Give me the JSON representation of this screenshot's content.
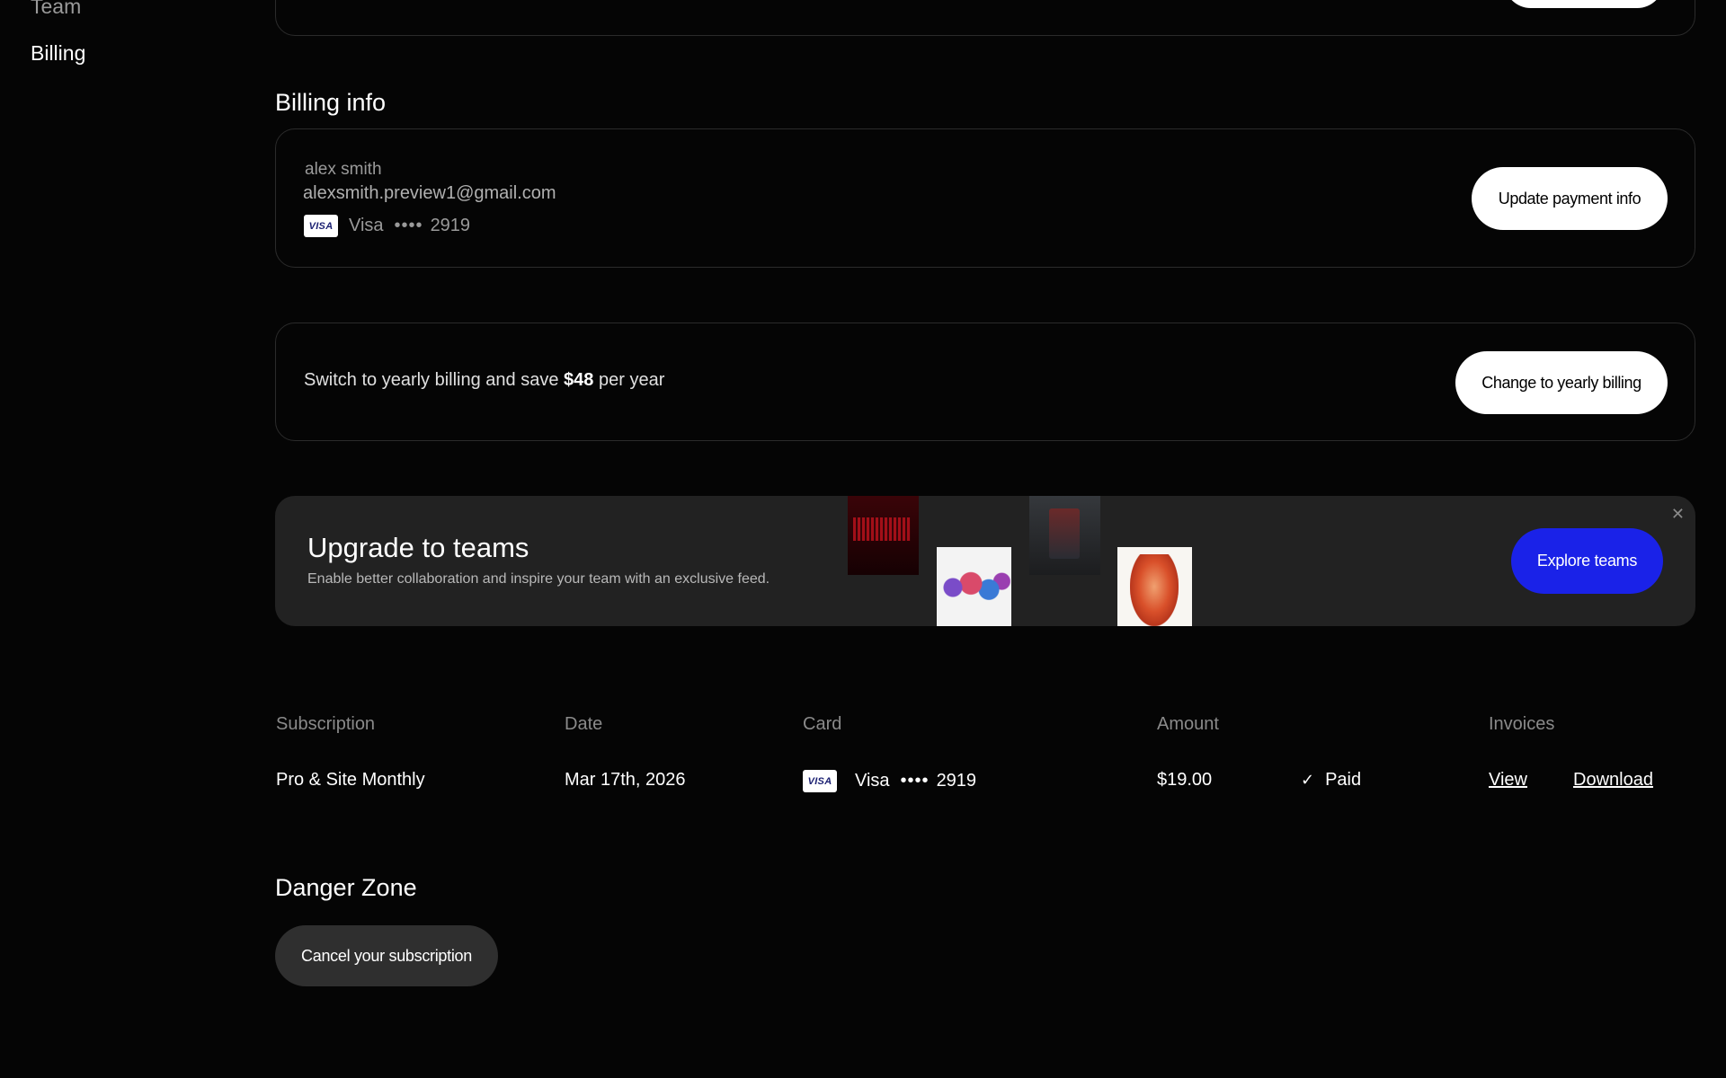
{
  "sidebar": {
    "items": [
      {
        "label": "Team"
      },
      {
        "label": "Billing"
      }
    ]
  },
  "billing_info": {
    "title": "Billing info",
    "name": "alex smith",
    "email": "alexsmith.preview1@gmail.com",
    "card_brand": "Visa",
    "card_badge": "VISA",
    "card_dots": "••••",
    "card_last4": "2919",
    "update_button": "Update payment info"
  },
  "yearly": {
    "text_before": "Switch to yearly billing and save ",
    "savings": "$48",
    "text_after": " per year",
    "button": "Change to yearly billing"
  },
  "teams_promo": {
    "title": "Upgrade to teams",
    "subtitle": "Enable better collaboration and inspire your team with an exclusive feed.",
    "button": "Explore teams",
    "close_icon": "✕"
  },
  "invoices_table": {
    "headers": [
      "Subscription",
      "Date",
      "Card",
      "Amount",
      "Invoices"
    ],
    "rows": [
      {
        "subscription": "Pro & Site Monthly",
        "date": "Mar 17th, 2026",
        "card_badge": "VISA",
        "card_brand": "Visa",
        "card_dots": "••••",
        "card_last4": "2919",
        "amount": "$19.00",
        "status": "Paid",
        "view_link": "View",
        "download_link": "Download"
      }
    ]
  },
  "danger_zone": {
    "title": "Danger Zone",
    "cancel_button": "Cancel your subscription"
  },
  "colors": {
    "background": "#050505",
    "accent_blue": "#1a22e8",
    "card_border": "#2b2b2b",
    "promo_bg": "#222222"
  }
}
